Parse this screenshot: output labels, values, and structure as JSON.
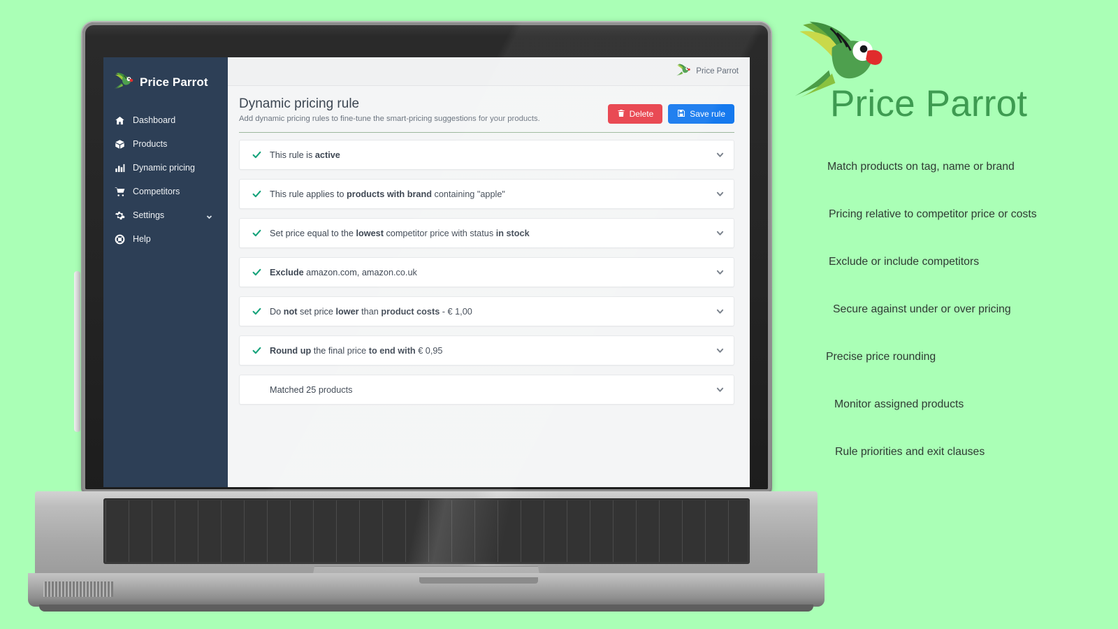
{
  "background_color": "#aaffb6",
  "app": {
    "sidebar": {
      "brand": "Price Parrot",
      "brand_logo_icon": "parrot-logo-icon",
      "items": [
        {
          "label": "Dashboard",
          "icon": "home-icon",
          "has_caret": false
        },
        {
          "label": "Products",
          "icon": "box-icon",
          "has_caret": false
        },
        {
          "label": "Dynamic pricing",
          "icon": "bar-chart-icon",
          "has_caret": false
        },
        {
          "label": "Competitors",
          "icon": "shopping-cart-icon",
          "has_caret": false
        },
        {
          "label": "Settings",
          "icon": "gear-icon",
          "has_caret": true
        },
        {
          "label": "Help",
          "icon": "life-ring-icon",
          "has_caret": false
        }
      ]
    },
    "topbar": {
      "brand": "Price Parrot",
      "brand_logo_icon": "parrot-logo-icon"
    },
    "page": {
      "title": "Dynamic pricing rule",
      "subtitle": "Add dynamic pricing rules to fine-tune the smart-pricing suggestions for your products.",
      "divider_color": "#9db89d",
      "actions": [
        {
          "label": "Delete",
          "icon": "trash-icon",
          "color": "#e8404a"
        },
        {
          "label": "Save rule",
          "icon": "floppy-save-icon",
          "color": "#1579ee"
        }
      ]
    },
    "rules": [
      {
        "checked": true,
        "caret_icon": "chevron-down-icon",
        "segments": [
          {
            "text": "This rule is ",
            "bold": false
          },
          {
            "text": "active",
            "bold": true
          }
        ]
      },
      {
        "checked": true,
        "caret_icon": "chevron-down-icon",
        "segments": [
          {
            "text": "This rule applies to ",
            "bold": false
          },
          {
            "text": "products with brand",
            "bold": true
          },
          {
            "text": " containing \"apple\"",
            "bold": false
          }
        ]
      },
      {
        "checked": true,
        "caret_icon": "chevron-down-icon",
        "segments": [
          {
            "text": "Set price equal to the ",
            "bold": false
          },
          {
            "text": "lowest",
            "bold": true
          },
          {
            "text": " competitor price with status ",
            "bold": false
          },
          {
            "text": "in stock",
            "bold": true
          }
        ]
      },
      {
        "checked": true,
        "caret_icon": "chevron-down-icon",
        "segments": [
          {
            "text": "Exclude",
            "bold": true
          },
          {
            "text": " amazon.com, amazon.co.uk",
            "bold": false
          }
        ]
      },
      {
        "checked": true,
        "caret_icon": "chevron-down-icon",
        "segments": [
          {
            "text": "Do ",
            "bold": false
          },
          {
            "text": "not",
            "bold": true
          },
          {
            "text": " set price ",
            "bold": false
          },
          {
            "text": "lower",
            "bold": true
          },
          {
            "text": " than ",
            "bold": false
          },
          {
            "text": "product costs",
            "bold": true
          },
          {
            "text": " - € 1,00",
            "bold": false
          }
        ]
      },
      {
        "checked": true,
        "caret_icon": "chevron-down-icon",
        "segments": [
          {
            "text": "Round up",
            "bold": true
          },
          {
            "text": " the final price ",
            "bold": false
          },
          {
            "text": "to end with",
            "bold": true
          },
          {
            "text": " € 0,95",
            "bold": false
          }
        ]
      },
      {
        "checked": false,
        "caret_icon": "chevron-down-icon",
        "segments": [
          {
            "text": "Matched 25 products",
            "bold": false
          }
        ]
      }
    ]
  },
  "marketing": {
    "logo_icon": "parrot-logo-icon",
    "title": "Price Parrot",
    "title_color": "#3e9b51",
    "features": [
      "Match products on tag, name or brand",
      "Pricing relative to competitor price or costs",
      "Exclude or include competitors",
      "Secure against under or over pricing",
      "Precise price rounding",
      "Monitor assigned products",
      "Rule priorities and exit clauses"
    ]
  }
}
